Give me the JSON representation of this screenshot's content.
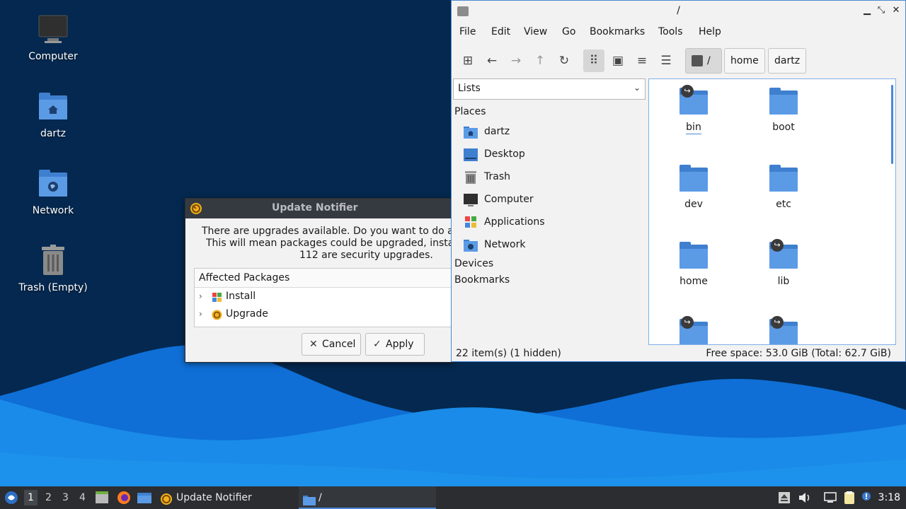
{
  "desktop": {
    "icons": [
      {
        "label": "Computer",
        "icon": "monitor-icon"
      },
      {
        "label": "dartz",
        "icon": "home-folder-icon"
      },
      {
        "label": "Network",
        "icon": "network-folder-icon"
      },
      {
        "label": "Trash (Empty)",
        "icon": "trash-icon"
      }
    ]
  },
  "notifier": {
    "title": "Update Notifier",
    "message_lines": [
      "There are upgrades available. Do you want to do a sy",
      "This will mean packages could be upgraded, installe",
      "112 are security upgrades."
    ],
    "packages_header": "Affected Packages",
    "packages": [
      {
        "label": "Install",
        "icon": "install-package-icon"
      },
      {
        "label": "Upgrade",
        "icon": "upgrade-package-icon"
      }
    ],
    "cancel_label": "Cancel",
    "apply_label": "Apply"
  },
  "file_manager": {
    "title": "/",
    "menu": [
      "File",
      "Edit",
      "View",
      "Go",
      "Bookmarks",
      "Tools",
      "Help"
    ],
    "breadcrumb": [
      "/",
      "home",
      "dartz"
    ],
    "side_pane_mode": "Lists",
    "places_header": "Places",
    "places": [
      {
        "label": "dartz",
        "icon": "home-folder-icon"
      },
      {
        "label": "Desktop",
        "icon": "desktop-icon"
      },
      {
        "label": "Trash",
        "icon": "trash-icon"
      },
      {
        "label": "Computer",
        "icon": "computer-icon"
      },
      {
        "label": "Applications",
        "icon": "applications-icon"
      },
      {
        "label": "Network",
        "icon": "network-icon"
      }
    ],
    "devices_header": "Devices",
    "bookmarks_header": "Bookmarks",
    "files": [
      {
        "name": "bin",
        "symlink": true
      },
      {
        "name": "boot",
        "symlink": false
      },
      {
        "name": "dev",
        "symlink": false
      },
      {
        "name": "etc",
        "symlink": false
      },
      {
        "name": "home",
        "symlink": false
      },
      {
        "name": "lib",
        "symlink": true
      },
      {
        "name": "",
        "symlink": true
      },
      {
        "name": "",
        "symlink": true
      }
    ],
    "status_left": "22 item(s) (1 hidden)",
    "status_right": "Free space: 53.0 GiB (Total: 62.7 GiB)"
  },
  "taskbar": {
    "workspaces": [
      "1",
      "2",
      "3",
      "4"
    ],
    "current_workspace": "1",
    "tasks": [
      {
        "label": "Update Notifier",
        "icon": "update-notifier-icon"
      },
      {
        "label": "/",
        "icon": "folder-icon"
      }
    ],
    "clock": "3:18"
  },
  "colors": {
    "accent": "#4a89d6",
    "folder": "#5b9be6",
    "desktop_bg": "#04284f",
    "taskbar_bg": "#2b2d31"
  }
}
